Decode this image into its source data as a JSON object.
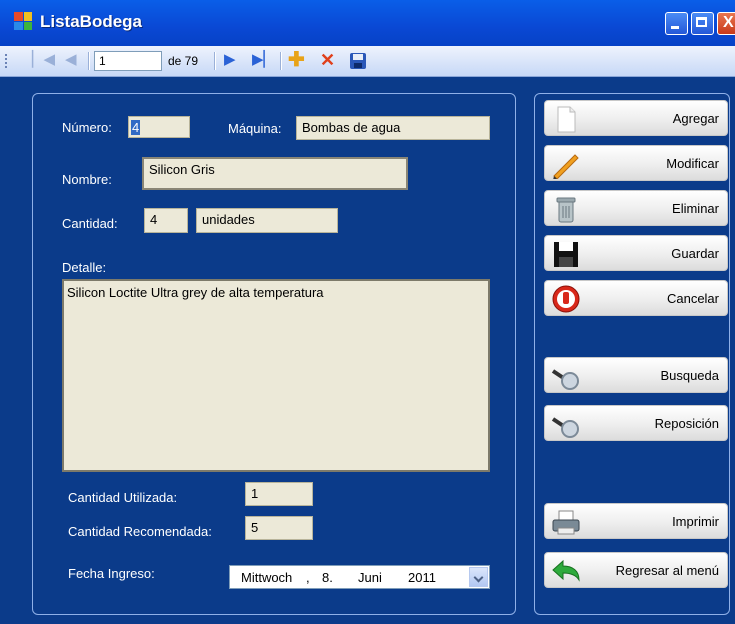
{
  "window": {
    "title": "ListaBodega"
  },
  "toolbar": {
    "position_value": "1",
    "of_label": "de 79"
  },
  "form": {
    "numero_label": "Número:",
    "numero_value": "4",
    "maquina_label": "Máquina:",
    "maquina_value": "Bombas de agua",
    "nombre_label": "Nombre:",
    "nombre_value": "Silicon Gris",
    "cantidad_label": "Cantidad:",
    "cantidad_value": "4",
    "unidad_value": "unidades",
    "detalle_label": "Detalle:",
    "detalle_value": "Silicon Loctite Ultra grey de alta temperatura",
    "utilizada_label": "Cantidad Utilizada:",
    "utilizada_value": "1",
    "recomendada_label": "Cantidad Recomendada:",
    "recomendada_value": "5",
    "fecha_label": "Fecha Ingreso:",
    "fecha": {
      "weekday": "Mittwoch",
      "sep": ",",
      "day": "8.",
      "month": "Juni",
      "year": "2011"
    }
  },
  "buttons": {
    "agregar": "Agregar",
    "modificar": "Modificar",
    "eliminar": "Eliminar",
    "guardar": "Guardar",
    "cancelar": "Cancelar",
    "busqueda": "Busqueda",
    "reposicion": "Reposición",
    "imprimir": "Imprimir",
    "regresar": "Regresar al menú"
  },
  "icons": {
    "app": "app-grid-icon",
    "first": "first-record-icon",
    "prev": "prev-record-icon",
    "next": "next-record-icon",
    "last": "last-record-icon",
    "add": "add-record-icon",
    "delete": "delete-record-icon",
    "save": "save-record-icon"
  },
  "colors": {
    "form_bg": "#0b3b8a",
    "field_bg": "#ece9d8",
    "titlebar": "#0a5ee8"
  }
}
